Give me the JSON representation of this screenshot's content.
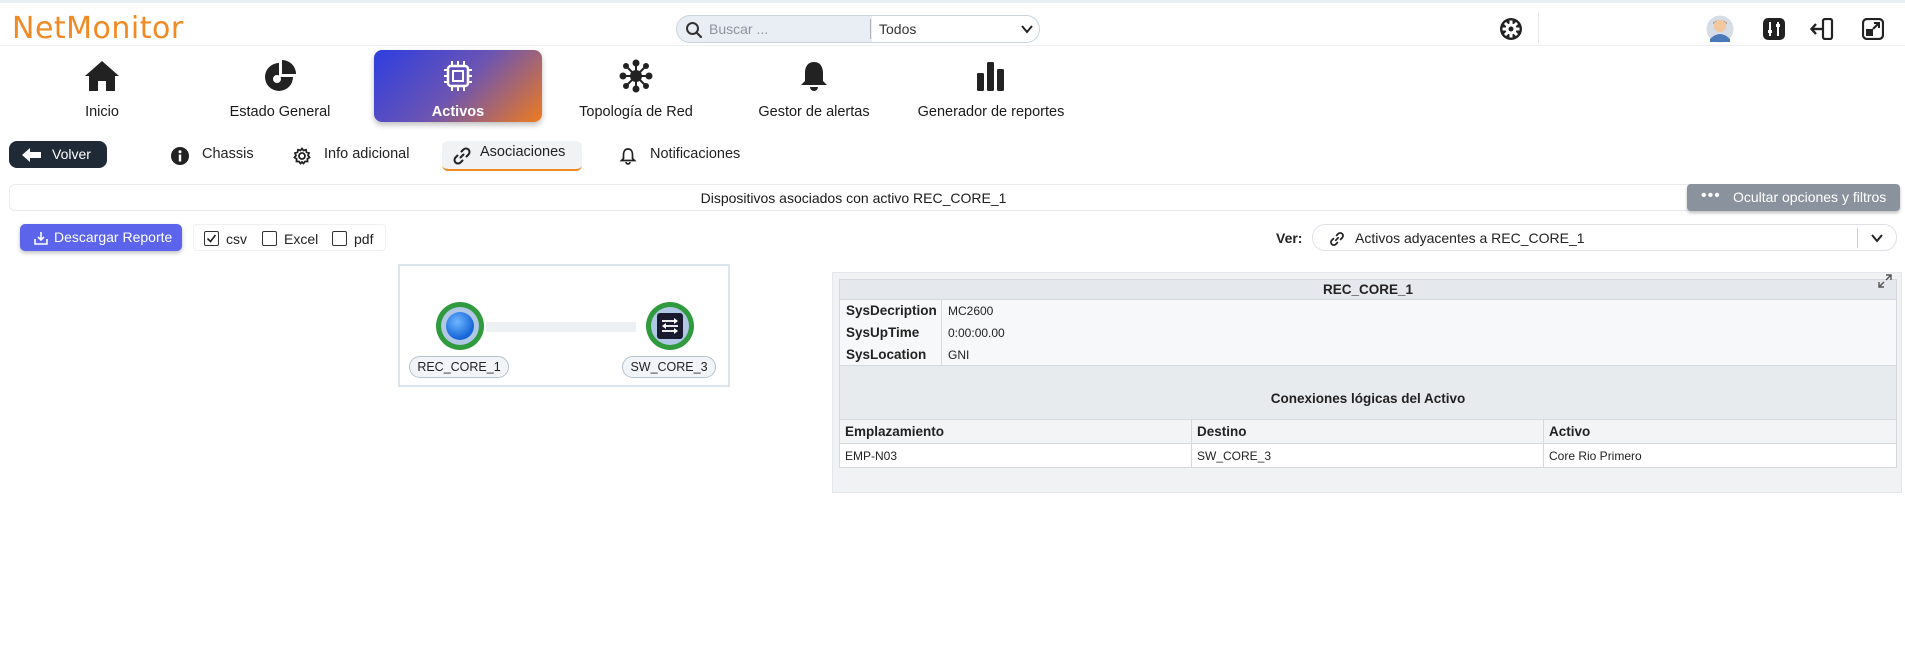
{
  "app": {
    "logo_text": "NetMonitor",
    "accent_color": "#f08a24"
  },
  "search": {
    "placeholder": "Buscar ...",
    "scope_selected": "Todos"
  },
  "header_icons": [
    "gear-icon",
    "user-avatar-icon",
    "sliders-icon",
    "logout-icon",
    "expand-window-icon"
  ],
  "nav": {
    "items": [
      {
        "label": "Inicio",
        "icon": "home-icon"
      },
      {
        "label": "Estado General",
        "icon": "pie-chart-icon"
      },
      {
        "label": "Activos",
        "icon": "chip-icon",
        "active": true
      },
      {
        "label": "Topología de Red",
        "icon": "network-topology-icon"
      },
      {
        "label": "Gestor de alertas",
        "icon": "bell-icon"
      },
      {
        "label": "Generador de reportes",
        "icon": "bar-chart-icon"
      }
    ]
  },
  "subnav": {
    "back_label": "Volver",
    "tabs": [
      {
        "label": "Chassis",
        "icon": "info-icon"
      },
      {
        "label": "Info adicional",
        "icon": "gear-icon"
      },
      {
        "label": "Asociaciones",
        "icon": "link-icon",
        "active": true
      },
      {
        "label": "Notificaciones",
        "icon": "bell-icon"
      }
    ]
  },
  "title": {
    "text": "Dispositivos asociados con activo REC_CORE_1",
    "toggle_options_label": "Ocultar opciones y filtros"
  },
  "report": {
    "download_label": "Descargar Reporte",
    "formats": [
      {
        "label": "csv",
        "checked": true
      },
      {
        "label": "Excel",
        "checked": false
      },
      {
        "label": "pdf",
        "checked": false
      }
    ]
  },
  "view": {
    "label": "Ver:",
    "selected": "Activos adyacentes a REC_CORE_1"
  },
  "graph": {
    "nodes": [
      {
        "label": "REC_CORE_1",
        "icon": "router-sphere-icon"
      },
      {
        "label": "SW_CORE_3",
        "icon": "switch-icon"
      }
    ]
  },
  "details": {
    "asset_name": "REC_CORE_1",
    "properties": [
      {
        "key": "SysDecription",
        "value": "MC2600"
      },
      {
        "key": "SysUpTime",
        "value": "0:00:00.00"
      },
      {
        "key": "SysLocation",
        "value": "GNI"
      }
    ],
    "connections_title": "Conexiones lógicas del Activo",
    "columns": [
      "Emplazamiento",
      "Destino",
      "Activo"
    ],
    "rows": [
      [
        "EMP-N03",
        "SW_CORE_3",
        "Core Rio Primero"
      ]
    ]
  }
}
